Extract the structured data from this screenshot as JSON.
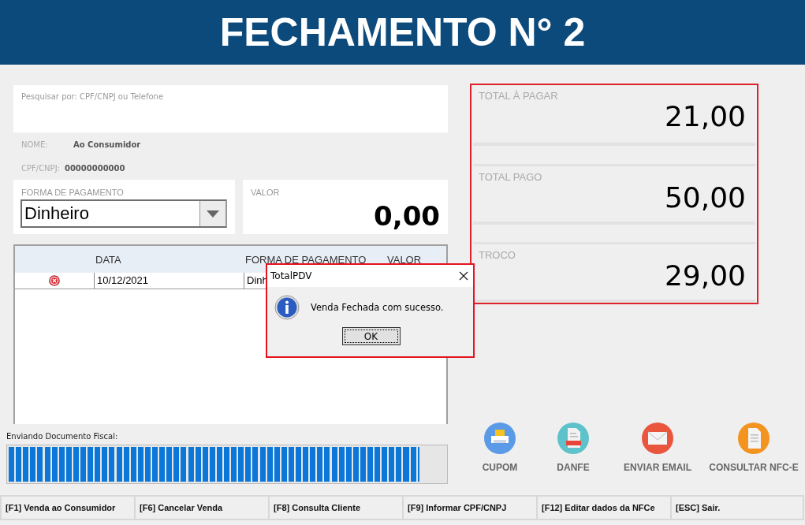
{
  "header": {
    "title": "FECHAMENTO N° 2"
  },
  "search": {
    "placeholder": "Pesquisar por: CPF/CNPJ ou Telefone"
  },
  "customer": [
    {
      "label": "NOME:",
      "value": "Ao Consumidor"
    },
    {
      "label": "CPF/CNPJ:",
      "value": "00000000000"
    }
  ],
  "payment": {
    "label": "FORMA DE PAGAMENTO",
    "value": "Dinheiro"
  },
  "amount": {
    "label": "VALOR",
    "value": "0,00"
  },
  "table": {
    "columns": [
      "DATA",
      "FORMA DE PAGAMENTO",
      "VALOR"
    ],
    "rows": [
      {
        "date": "10/12/2021",
        "method": "Dinh"
      }
    ]
  },
  "progress": {
    "label": "Enviando Documento Fiscal:",
    "level": 0.94
  },
  "totals": [
    {
      "label": "TOTAL À PAGAR",
      "value": "21,00"
    },
    {
      "label": "TOTAL PAGO",
      "value": "50,00"
    },
    {
      "label": "TROCO",
      "value": "29,00"
    }
  ],
  "actions": [
    {
      "kind": "printer",
      "label": "CUPOM"
    },
    {
      "kind": "pdf",
      "label": "DANFE"
    },
    {
      "kind": "mail",
      "label": "ENVIAR EMAIL"
    },
    {
      "kind": "document",
      "label": "CONSULTAR NFC-E"
    }
  ],
  "footer": [
    "[F1] Venda ao Consumidor",
    "[F6] Cancelar Venda",
    "[F8] Consulta Cliente",
    "[F9] Informar CPF/CNPJ",
    "[F12] Editar dados da NFCe",
    "[ESC] Sair."
  ],
  "dialog": {
    "title": "TotalPDV",
    "message": "Venda Fechada com sucesso.",
    "button": "OK"
  }
}
